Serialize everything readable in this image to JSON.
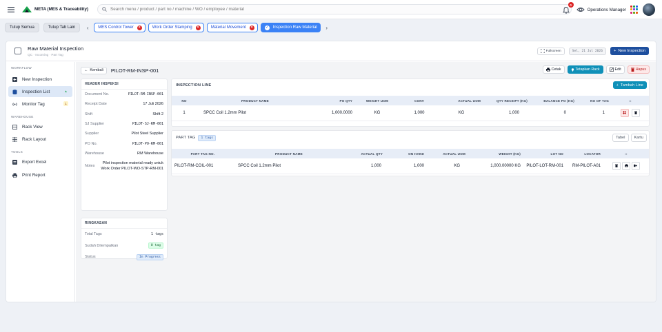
{
  "app": {
    "title": "META (MES & Traceability)",
    "search_placeholder": "Search menu / product / part no / machine / WO / employee / material",
    "notification_count": "0",
    "user_name": "Operations Manager"
  },
  "tabbar": {
    "close_all": "Tutup Semua",
    "close_other": "Tutup Tab Lain",
    "tabs": [
      {
        "label": "MES Control Tower"
      },
      {
        "label": "Work Order Stamping"
      },
      {
        "label": "Material Movement"
      },
      {
        "label": "Inspection Raw Material"
      }
    ]
  },
  "page": {
    "title": "Raw Material Inspection",
    "breadcrumb": "QC  ·  Incoming  ·  Part Tag",
    "fullscreen": "Fullscreen",
    "date": "Sel, 21 Jul 2026",
    "new_button": "New Inspection"
  },
  "sidebar": {
    "workflow_label": "WORKFLOW",
    "warehouse_label": "WAREHOUSE",
    "tools_label": "TOOLS",
    "items": [
      {
        "label": "New Inspection"
      },
      {
        "label": "Inspection List",
        "badge": "▲"
      },
      {
        "label": "Monitor Tag",
        "badge": "1"
      },
      {
        "label": "Rack View"
      },
      {
        "label": "Rack Layout"
      },
      {
        "label": "Export Excel"
      },
      {
        "label": "Print Report"
      }
    ]
  },
  "detail": {
    "back": "Kembali",
    "doc_title": "PILOT-RM-INSP-001",
    "actions": {
      "print": "Cetak",
      "rack": "Tetapkan Rack",
      "edit": "Edit",
      "delete": "Hapus"
    },
    "header_label": "HEADER INSPEKSI",
    "fields": [
      {
        "k": "Document No.",
        "v": "PILOT-RM-INSP-001"
      },
      {
        "k": "Receipt Date",
        "v": "17 Juli 2026"
      },
      {
        "k": "Shift",
        "v": "Shift 2"
      },
      {
        "k": "SJ Supplier",
        "v": "PILOT-SJ-RM-001"
      },
      {
        "k": "Supplier",
        "v": "Pilot Steel Supplier"
      },
      {
        "k": "PO No.",
        "v": "PILOT-PO-RM-001"
      },
      {
        "k": "Warehouse",
        "v": "RM Warehouse"
      },
      {
        "k": "Notes",
        "v": "Pilot inspection material ready untuk Work Order PILOT-WO-STP-RM-001"
      }
    ],
    "summary_label": "RINGKASAN",
    "summary": [
      {
        "k": "Total Tags",
        "v": "1 tags"
      },
      {
        "k": "Sudah Ditempatkan",
        "v": "0 tag"
      },
      {
        "k": "Status",
        "v": "In Progress"
      }
    ]
  },
  "inspection_line": {
    "title": "INSPECTION LINE",
    "add_button": "Tambah Line",
    "headers": [
      "NO",
      "PRODUCT NAME",
      "PO QTY",
      "WEIGHT UOM",
      "CONV",
      "ACTUAL UOM",
      "QTY RECEIPT (KG)",
      "BALANCE PO (KG)",
      "NO OF TAG",
      "::"
    ],
    "rows": [
      {
        "no": "1",
        "product": "SPCC Coil 1.2mm Pilot",
        "po_qty": "1,000.0000",
        "weight_uom": "KG",
        "conv": "1,000",
        "actual_uom": "KG",
        "qty_receipt": "1,000",
        "balance": "0",
        "tags": "1"
      }
    ]
  },
  "part_tag": {
    "title": "PART TAG",
    "count": "1 tags",
    "view_table": "Tabel",
    "view_card": "Kartu",
    "headers": [
      "PART TAG NO.",
      "PRODUCT NAME",
      "ACTUAL QTY",
      "ON HAND",
      "ACTUAL UOM",
      "WEIGHT (KG)",
      "LOT NO",
      "LOCATOR",
      "::"
    ],
    "rows": [
      {
        "tag": "PILOT-RM-COIL-001",
        "product": "SPCC Coil 1.2mm Pilot",
        "actual_qty": "1,000",
        "on_hand": "1,000",
        "uom": "KG",
        "weight": "1,000.00000 KG",
        "lot": "PILOT-LOT-RM-001",
        "locator": "RM-PILOT-A01"
      }
    ]
  },
  "colors": {
    "brand": "#1e4f9e",
    "teal": "#0f90b8",
    "danger": "#dc2626",
    "active_tab": "#3b82f6"
  }
}
